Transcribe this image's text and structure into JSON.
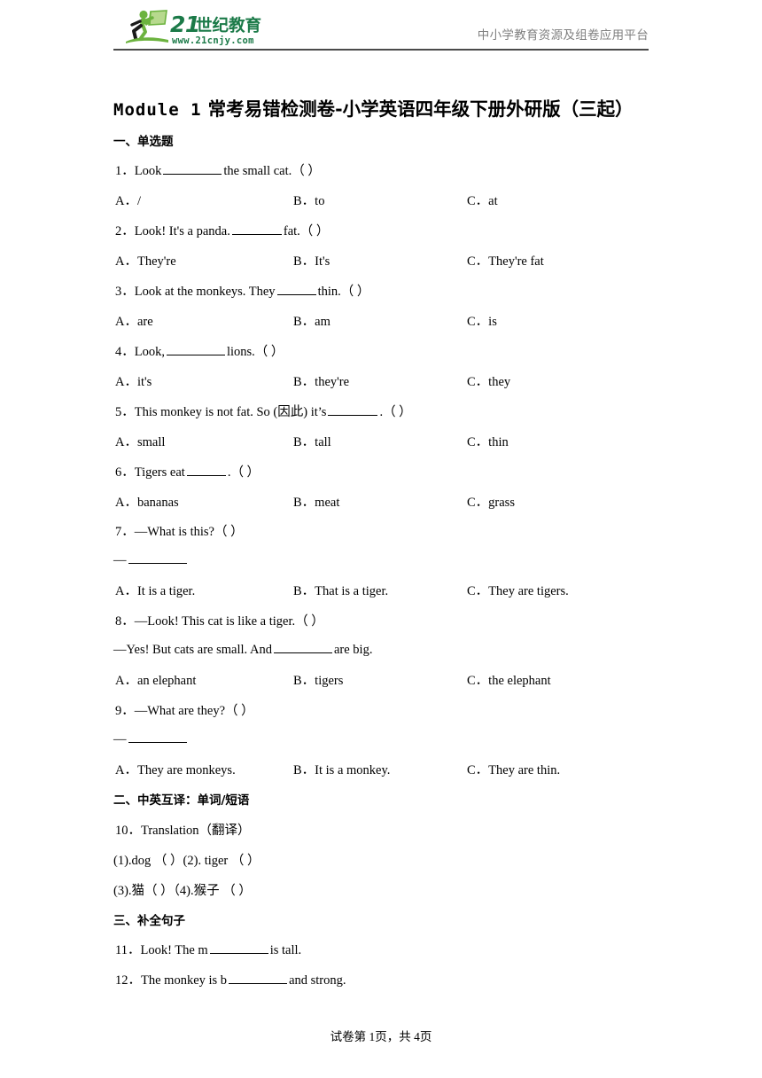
{
  "header": {
    "logo_main": "21世纪教育",
    "logo_url": "www.21cnjy.com",
    "tagline": "中小学教育资源及组卷应用平台",
    "brand_green": "#1b7a48",
    "brand_light_green": "#6cb33f",
    "rule_color": "#4a4a4a"
  },
  "title": {
    "latin": "Module 1",
    "chinese": " 常考易错检测卷-小学英语四年级下册外研版（三起）"
  },
  "sections": [
    {
      "heading": "一、单选题"
    },
    {
      "heading": "二、中英互译：单词/短语"
    },
    {
      "heading": "三、补全句子"
    }
  ],
  "questions": {
    "q1": {
      "number": "1．",
      "text_before": "Look",
      "text_after": "the small cat.（ ）",
      "options": {
        "a": "A．/",
        "b": "B．to",
        "c": "C．at"
      }
    },
    "q2": {
      "number": "2．",
      "text_before": "Look! It's a panda.",
      "text_after": "fat.（ ）",
      "options": {
        "a": "A．They're",
        "b": "B．It's",
        "c": "C．They're fat"
      }
    },
    "q3": {
      "number": "3．",
      "text_before": "Look at the monkeys. They",
      "text_after": "thin.（  ）",
      "options": {
        "a": "A．are",
        "b": "B．am",
        "c": "C．is"
      }
    },
    "q4": {
      "number": "4．",
      "text_before": "Look,",
      "text_after": "lions.（ ）",
      "options": {
        "a": "A．it's",
        "b": "B．they're",
        "c": "C．they"
      }
    },
    "q5": {
      "number": "5．",
      "text_before": "This monkey is not fat. So (因此) it’s",
      "text_after": ".（ ）",
      "options": {
        "a": "A．small",
        "b": "B．tall",
        "c": "C．thin"
      }
    },
    "q6": {
      "number": "6．",
      "text_before": "Tigers eat",
      "text_after": ".（  ）",
      "options": {
        "a": "A．bananas",
        "b": "B．meat",
        "c": "C．grass"
      }
    },
    "q7": {
      "number": "7．",
      "text": "—What is this?（  ）",
      "answer_dash": "—",
      "options": {
        "a": "A．It is a tiger.",
        "b": "B．That is a tiger.",
        "c": "C．They are tigers."
      }
    },
    "q8": {
      "number": "8．",
      "text": "—Look! This cat is like a tiger.（  ）",
      "line2_before": "—Yes! But cats are small. And",
      "line2_after": "are big.",
      "options": {
        "a": "A．an elephant",
        "b": "B．tigers",
        "c": "C．the elephant"
      }
    },
    "q9": {
      "number": "9．",
      "text": "—What are they?（  ）",
      "answer_dash": "—",
      "options": {
        "a": "A．They are monkeys.",
        "b": "B．It is a monkey.",
        "c": "C．They are thin."
      }
    },
    "q10": {
      "number": "10．",
      "text": "Translation（翻译）",
      "row1": "(1).dog （              ）(2). tiger （                  ）",
      "row2": "(3).猫（              ）（4).猴子 （                ）"
    },
    "q11": {
      "number": "11．",
      "text_before": "Look! The m",
      "text_after": "is tall."
    },
    "q12": {
      "number": "12．",
      "text_before": "The monkey is b",
      "text_after": "and strong."
    }
  },
  "footer": {
    "text": "试卷第 1页，共 4页"
  }
}
